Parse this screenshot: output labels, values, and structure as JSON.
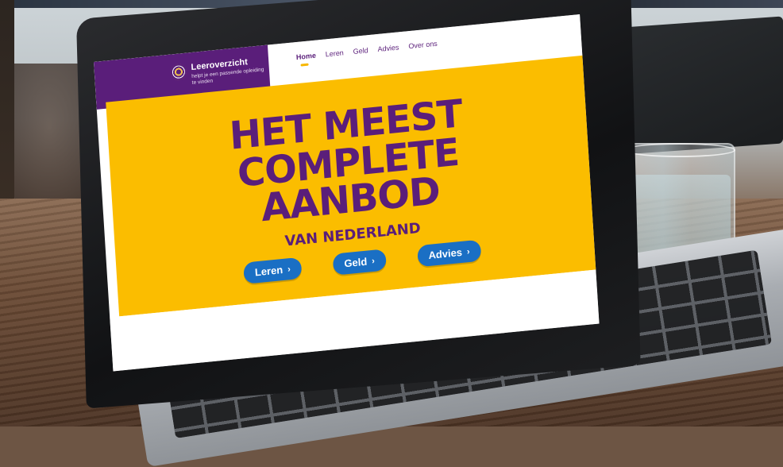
{
  "site": {
    "brand_name": "Leeroverzicht",
    "brand_tagline": "helpt je een passende opleiding te vinden",
    "nav": [
      {
        "label": "Home",
        "active": true
      },
      {
        "label": "Leren",
        "active": false
      },
      {
        "label": "Geld",
        "active": false
      },
      {
        "label": "Advies",
        "active": false
      },
      {
        "label": "Over ons",
        "active": false
      }
    ],
    "hero": {
      "line1": "HET MEEST",
      "line2": "COMPLETE",
      "line3": "AANBOD",
      "subline": "VAN NEDERLAND"
    },
    "cta": [
      {
        "label": "Leren",
        "icon": "chevron-right-icon"
      },
      {
        "label": "Geld",
        "icon": "chevron-right-icon"
      },
      {
        "label": "Advies",
        "icon": "chevron-right-icon"
      }
    ]
  },
  "colors": {
    "brand_purple": "#5a1e7a",
    "hero_yellow": "#fbbd00",
    "button_blue": "#1a6fc4"
  }
}
